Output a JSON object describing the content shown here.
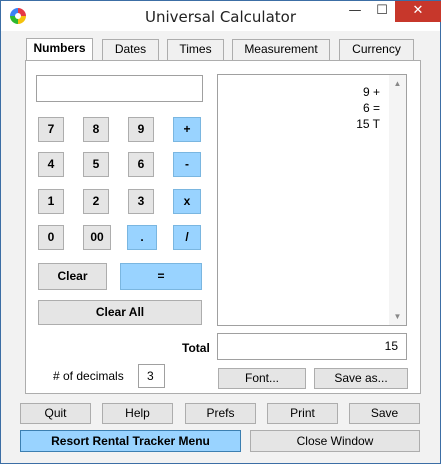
{
  "window": {
    "title": "Universal Calculator",
    "controls": {
      "minimize": "—",
      "maximize": "☐",
      "close": "✕"
    }
  },
  "tabs": [
    {
      "label": "Numbers",
      "active": true
    },
    {
      "label": "Dates",
      "active": false
    },
    {
      "label": "Times",
      "active": false
    },
    {
      "label": "Measurement",
      "active": false
    },
    {
      "label": "Currency",
      "active": false
    }
  ],
  "entry_display": {
    "value": ""
  },
  "keypad": {
    "k7": "7",
    "k8": "8",
    "k9": "9",
    "plus": "+",
    "k4": "4",
    "k5": "5",
    "k6": "6",
    "minus": "-",
    "k1": "1",
    "k2": "2",
    "k3": "3",
    "multiply": "x",
    "k0": "0",
    "k00": "00",
    "dot": ".",
    "divide": "/",
    "clear": "Clear",
    "equals": "=",
    "clear_all": "Clear All"
  },
  "tape": {
    "lines": [
      "9 +",
      "6 =",
      "15 T"
    ]
  },
  "total": {
    "label": "Total",
    "value": "15"
  },
  "decimals": {
    "label": "# of decimals",
    "value": "3"
  },
  "tape_buttons": {
    "font": "Font...",
    "save_as": "Save as..."
  },
  "bottom_buttons": {
    "quit": "Quit",
    "help": "Help",
    "prefs": "Prefs",
    "print": "Print",
    "save": "Save",
    "resort_menu": "Resort Rental Tracker Menu",
    "close_window": "Close Window"
  },
  "colors": {
    "accent_blue": "#99d3ff",
    "close_red": "#c7372b",
    "panel_bg": "#ffffff",
    "window_bg": "#f2f2f2"
  },
  "icons": {
    "app": "calculator-app-icon"
  }
}
